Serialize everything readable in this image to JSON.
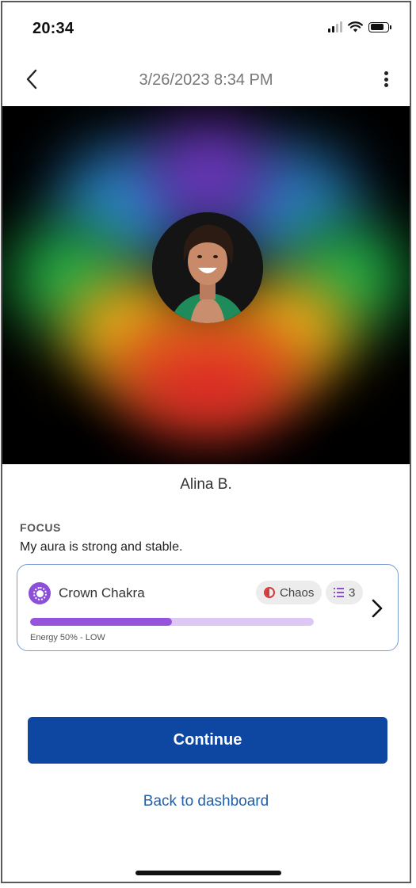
{
  "status_bar": {
    "time": "20:34"
  },
  "header": {
    "title": "3/26/2023 8:34 PM"
  },
  "aura": {
    "colors": [
      "#3a9ae0",
      "#7c3ad0",
      "#22b34a",
      "#f0c020",
      "#f07a18",
      "#e02828"
    ]
  },
  "profile": {
    "name": "Alina B."
  },
  "focus": {
    "label": "FOCUS",
    "text": "My aura is strong and stable."
  },
  "chakra_card": {
    "name": "Crown Chakra",
    "chaos_label": "Chaos",
    "count": "3",
    "energy_percent": 50,
    "energy_label": "Energy 50% - LOW",
    "accent_color": "#9654dc"
  },
  "actions": {
    "continue_label": "Continue",
    "back_link": "Back to dashboard"
  },
  "colors": {
    "primary_button": "#0d47a1",
    "link": "#1f5fa8",
    "card_border": "#7a9bd1"
  }
}
